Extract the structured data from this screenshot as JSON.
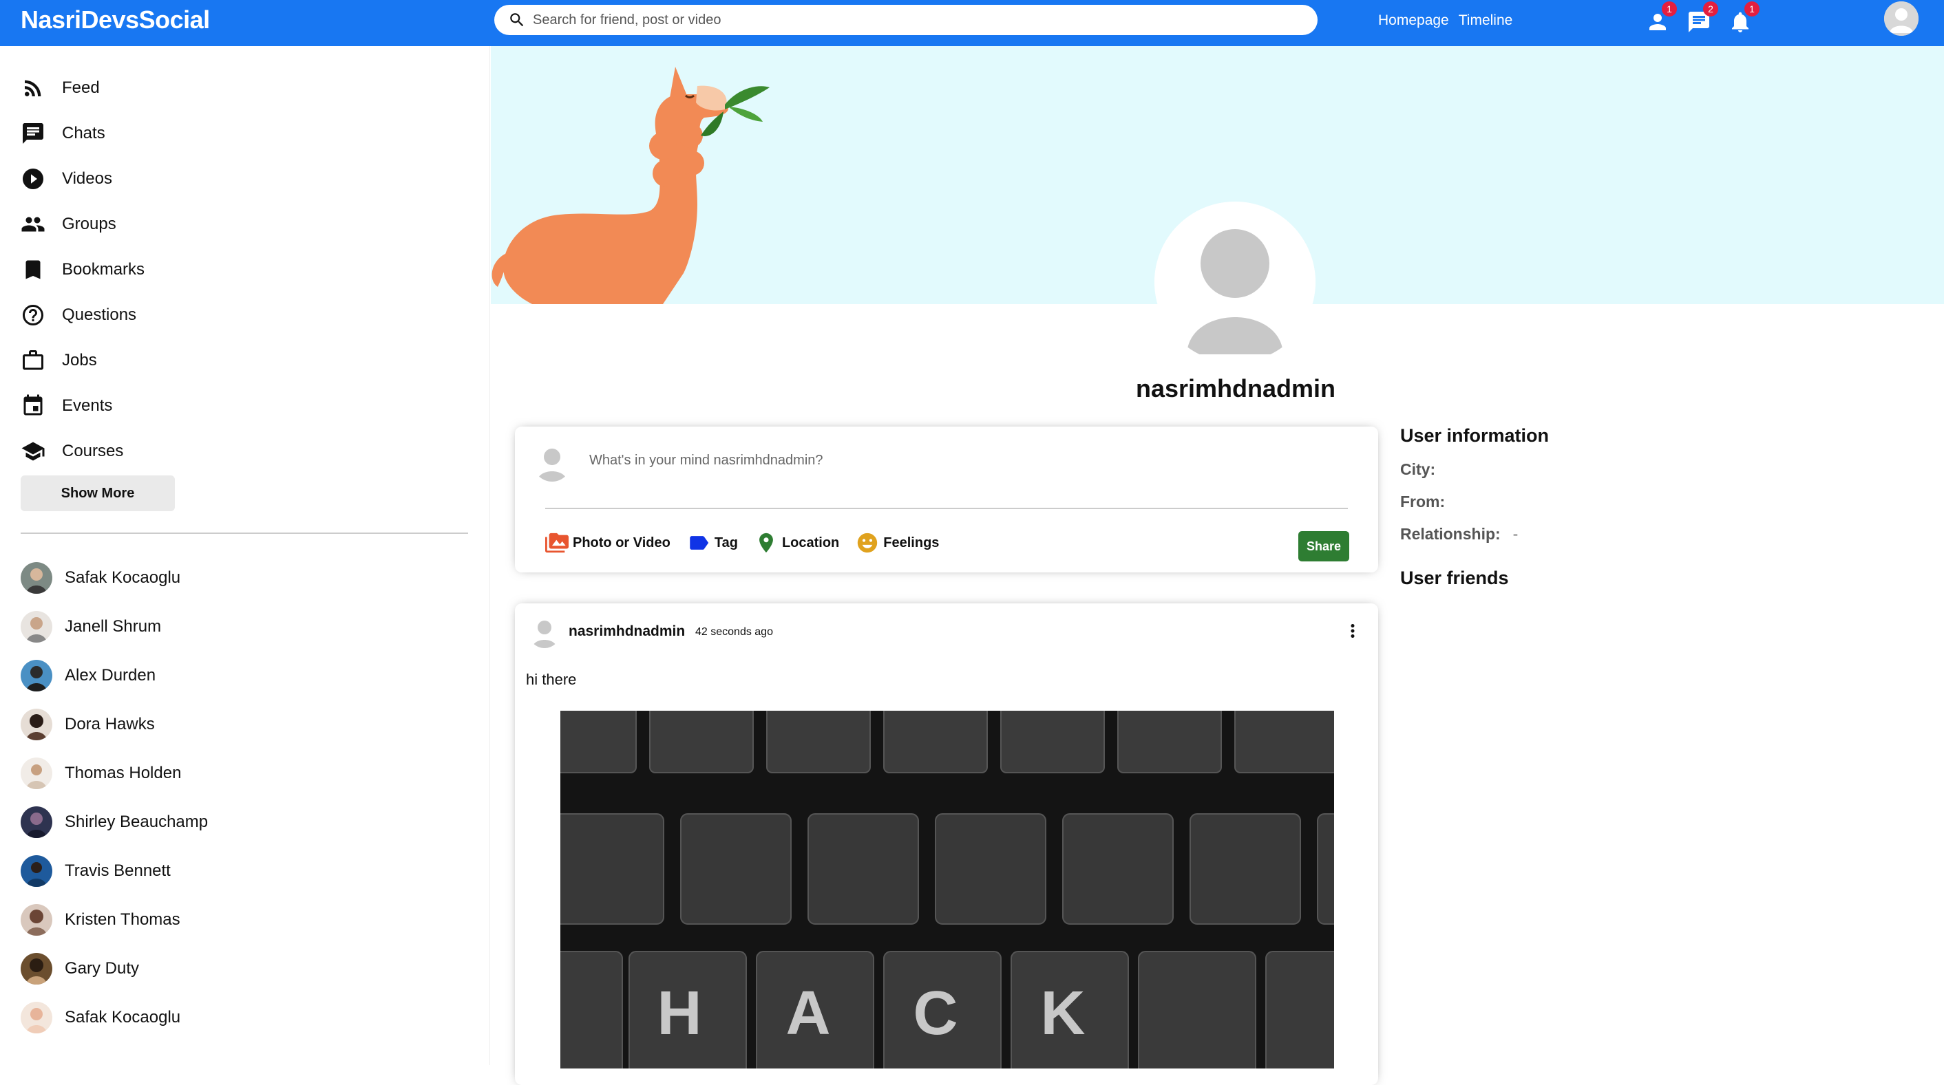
{
  "topbar": {
    "logo": "NasriDevsSocial",
    "search_placeholder": "Search for friend, post or video",
    "links": [
      "Homepage",
      "Timeline"
    ],
    "badges": {
      "friends": "1",
      "chats": "2",
      "notifications": "1"
    },
    "accent_color": "#1877f2"
  },
  "sidebar": {
    "items": [
      {
        "label": "Feed",
        "icon": "rss-feed-icon"
      },
      {
        "label": "Chats",
        "icon": "chat-icon"
      },
      {
        "label": "Videos",
        "icon": "play-circle-icon"
      },
      {
        "label": "Groups",
        "icon": "group-icon"
      },
      {
        "label": "Bookmarks",
        "icon": "bookmark-icon"
      },
      {
        "label": "Questions",
        "icon": "help-outline-icon"
      },
      {
        "label": "Jobs",
        "icon": "work-outline-icon"
      },
      {
        "label": "Events",
        "icon": "event-icon"
      },
      {
        "label": "Courses",
        "icon": "school-icon"
      }
    ],
    "show_more": "Show More",
    "friends": [
      "Safak Kocaoglu",
      "Janell Shrum",
      "Alex Durden",
      "Dora Hawks",
      "Thomas Holden",
      "Shirley Beauchamp",
      "Travis Bennett",
      "Kristen Thomas",
      "Gary Duty",
      "Safak Kocaoglu"
    ]
  },
  "profile": {
    "username": "nasrimhdnadmin"
  },
  "share": {
    "placeholder": "What's in your mind nasrimhdnadmin?",
    "options": [
      {
        "label": "Photo or Video",
        "icon": "perm-media-icon",
        "color": "#e8552f"
      },
      {
        "label": "Tag",
        "icon": "label-icon",
        "color": "#1034e6"
      },
      {
        "label": "Location",
        "icon": "room-icon",
        "color": "#2e7d32"
      },
      {
        "label": "Feelings",
        "icon": "emoji-emotions-icon",
        "color": "#e0a21e"
      }
    ],
    "button": "Share",
    "button_color": "#2e7d32"
  },
  "post": {
    "author": "nasrimhdnadmin",
    "date": "42 seconds ago",
    "text": "hi there",
    "image_keys": [
      "H",
      "A",
      "C",
      "K"
    ]
  },
  "user_info": {
    "title": "User information",
    "fields": [
      {
        "key": "City:",
        "value": ""
      },
      {
        "key": "From:",
        "value": ""
      },
      {
        "key": "Relationship:",
        "value": "-"
      }
    ],
    "friends_title": "User friends"
  }
}
